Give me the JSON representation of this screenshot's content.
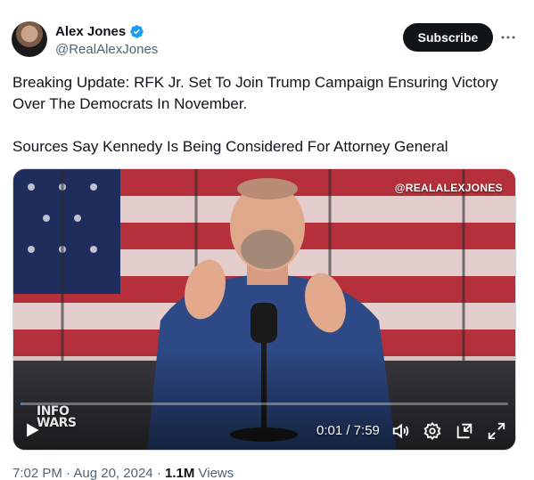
{
  "author": {
    "display_name": "Alex Jones",
    "handle": "@RealAlexJones",
    "verified": true
  },
  "actions": {
    "subscribe_label": "Subscribe",
    "more_icon": "more-horizontal-icon"
  },
  "tweet": {
    "line1": "Breaking Update: RFK Jr. Set To Join Trump Campaign Ensuring Victory",
    "line2": "Over The Democrats In November.",
    "line3": "Sources Say Kennedy Is Being Considered For Attorney General"
  },
  "video": {
    "watermark": "@REALALEXJONES",
    "brand_line1": "INFO",
    "brand_line2": "WARS",
    "time_display": "0:01 / 7:59",
    "progress_fraction": 0.002,
    "icons": [
      "play-icon",
      "volume-icon",
      "settings-gear-icon",
      "pip-icon",
      "fullscreen-icon"
    ]
  },
  "meta": {
    "time": "7:02 PM",
    "date": "Aug 20, 2024",
    "separator": "·",
    "views_count": "1.1M",
    "views_label": "Views"
  },
  "colors": {
    "accent": "#1d9bf0",
    "subscribe_bg": "#0f1419",
    "secondary_text": "#536471"
  }
}
